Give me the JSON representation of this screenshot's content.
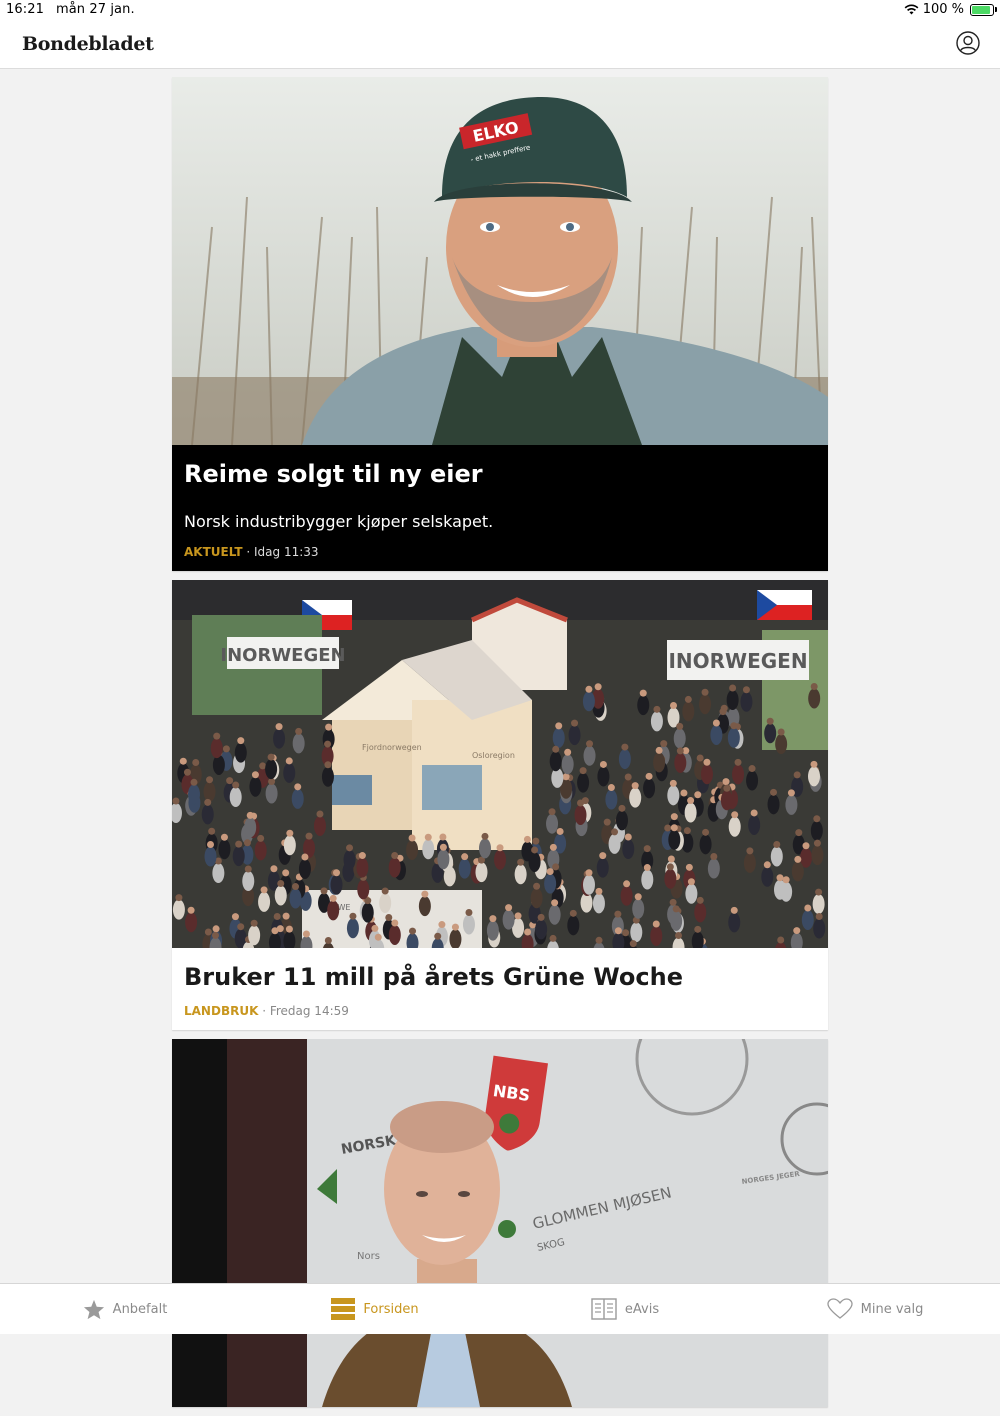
{
  "status": {
    "time": "16:21",
    "date": "mån 27 jan.",
    "battery": "100 %",
    "battery_level": 1.0
  },
  "header": {
    "brand": "Bondebladet"
  },
  "articles": [
    {
      "title": "Reime solgt til ny eier",
      "lead": "Norsk industribygger kjøper selskapet.",
      "section": "AKTUELT",
      "time": " · Idag 11:33"
    },
    {
      "title": "Bruker 11 mill på årets Grüne Woche",
      "section": "LANDBRUK",
      "time": " · Fredag 14:59"
    }
  ],
  "image_text": {
    "cap_logo": "ELKO",
    "cap_sub": "- et hakk preffere",
    "banner_left": "INORWEGEN",
    "banner_right": "INORWEGEN",
    "booth_left": "Fjordnorwegen",
    "booth_right": "Osloregion",
    "counter": "NORWE",
    "sign_nbs": "NBS",
    "sign_norsk": "NORSK",
    "sign_glommen": "GLOMMEN MJØSEN",
    "sign_skog": "SKOG",
    "sign_small": "Nors",
    "sign_right": "NORGES JEGER"
  },
  "tabs": [
    {
      "label": "Anbefalt",
      "icon": "star-icon",
      "active": false
    },
    {
      "label": "Forsiden",
      "icon": "front-page-icon",
      "active": true
    },
    {
      "label": "eAvis",
      "icon": "newspaper-icon",
      "active": false
    },
    {
      "label": "Mine valg",
      "icon": "heart-icon",
      "active": false
    }
  ],
  "colors": {
    "accent": "#c8961e",
    "inactive": "#8a8a8a",
    "lead_card_bg": "#000000"
  }
}
